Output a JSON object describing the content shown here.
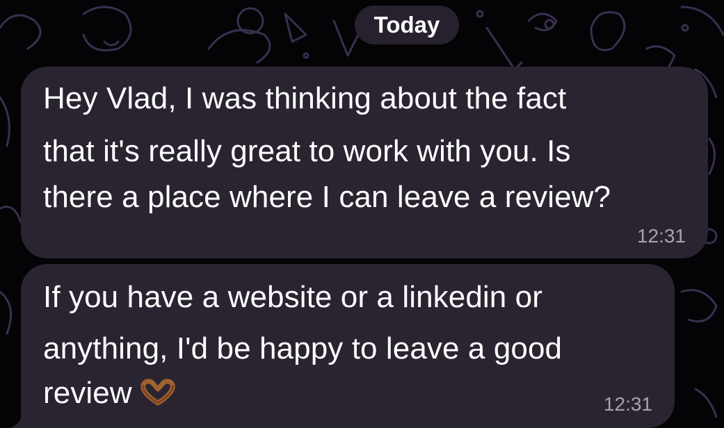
{
  "chat": {
    "date_separator": "Today",
    "messages": [
      {
        "lines": [
          "Hey Vlad, I was thinking about the fact",
          "that it's really great to work with you. Is",
          "there a place where I can leave a review?"
        ],
        "time": "12:31"
      },
      {
        "lines": [
          "If you have a website or a linkedin or",
          "anything, I'd be happy to leave a good",
          "review"
        ],
        "emoji": "heart-hands-emoji",
        "time": "12:31"
      }
    ]
  },
  "colors": {
    "background": "#040306",
    "bubble": "#2a2431",
    "pill": "#27212e",
    "text": "#ffffff",
    "timestamp": "#a8a2b0",
    "doodle": "#3b2f4f"
  }
}
